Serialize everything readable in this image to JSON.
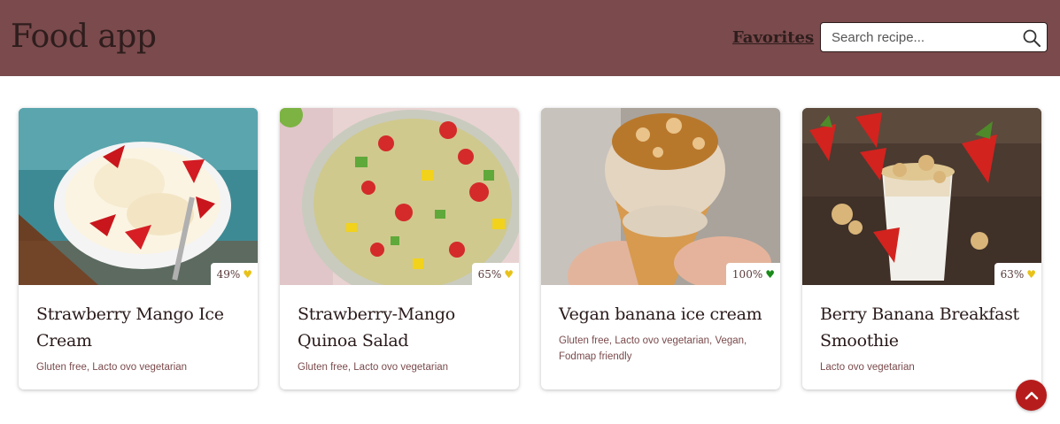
{
  "header": {
    "title": "Food app",
    "favorites_label": "Favorites",
    "search_placeholder": "Search recipe...",
    "bg_color": "#7a4a4c"
  },
  "recipes": [
    {
      "title": "Strawberry Mango Ice Cream",
      "tags": "Gluten free, Lacto ovo vegetarian",
      "score": "49%",
      "heart_color": "#e8c21a"
    },
    {
      "title": "Strawberry-Mango Quinoa Salad",
      "tags": "Gluten free, Lacto ovo vegetarian",
      "score": "65%",
      "heart_color": "#e8c21a"
    },
    {
      "title": "Vegan banana ice cream",
      "tags": "Gluten free, Lacto ovo vegetarian, Vegan, Fodmap friendly",
      "score": "100%",
      "heart_color": "#1a8a1a"
    },
    {
      "title": "Berry Banana Breakfast Smoothie",
      "tags": "Lacto ovo vegetarian",
      "score": "63%",
      "heart_color": "#e8c21a"
    }
  ],
  "icons": {
    "search": "search-icon",
    "heart": "heart-icon",
    "scroll_top": "chevron-up-icon"
  }
}
